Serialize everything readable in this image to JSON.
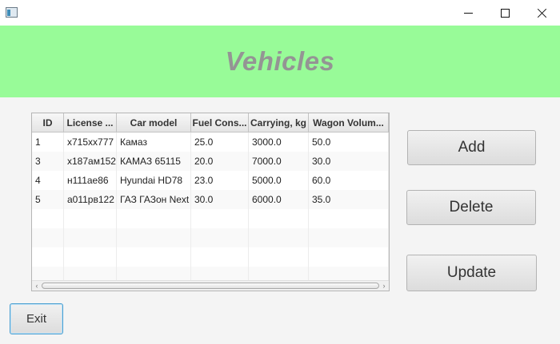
{
  "window": {
    "icon": "java-app-icon"
  },
  "header": {
    "title": "Vehicles",
    "background": "#98fb98"
  },
  "table": {
    "columns": [
      "ID",
      "License ...",
      "Car model",
      "Fuel Cons...",
      "Carrying, kg",
      "Wagon Volum..."
    ],
    "rows": [
      [
        "1",
        "х715хх777",
        "Камаз",
        "25.0",
        "3000.0",
        "50.0"
      ],
      [
        "3",
        "х187ам152",
        "КАМАЗ 65115",
        "20.0",
        "7000.0",
        "30.0"
      ],
      [
        "4",
        "н111ае86",
        "Hyundai HD78",
        "23.0",
        "5000.0",
        "60.0"
      ],
      [
        "5",
        "а011рв122",
        "ГАЗ ГАЗон Next",
        "30.0",
        "6000.0",
        "35.0"
      ]
    ]
  },
  "actions": {
    "add": "Add",
    "delete": "Delete",
    "update": "Update",
    "exit": "Exit"
  }
}
